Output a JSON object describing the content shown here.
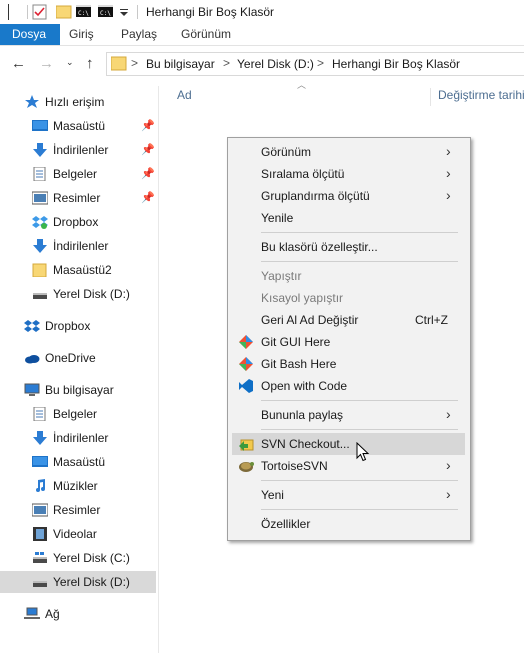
{
  "window": {
    "title": "Herhangi Bir Boş Klasör"
  },
  "ribbon": {
    "tabs": [
      "Dosya",
      "Giriş",
      "Paylaş",
      "Görünüm"
    ]
  },
  "address": {
    "crumbs": [
      "Bu bilgisayar",
      "Yerel Disk (D:)",
      "Herhangi Bir Boş Klasör"
    ],
    "separator": ">"
  },
  "nav": {
    "quick_access": "Hızlı erişim",
    "quick_items": [
      {
        "label": "Masaüstü",
        "icon": "desktop-icon",
        "pinned": true
      },
      {
        "label": "İndirilenler",
        "icon": "download-icon",
        "pinned": true
      },
      {
        "label": "Belgeler",
        "icon": "documents-icon",
        "pinned": true
      },
      {
        "label": "Resimler",
        "icon": "pictures-icon",
        "pinned": true
      },
      {
        "label": "Dropbox",
        "icon": "dropbox-icon",
        "pinned": false
      },
      {
        "label": "İndirilenler",
        "icon": "download-icon",
        "pinned": false
      },
      {
        "label": "Masaüstü2",
        "icon": "folder-icon",
        "pinned": false
      },
      {
        "label": "Yerel Disk (D:)",
        "icon": "drive-icon",
        "pinned": false
      }
    ],
    "dropbox": "Dropbox",
    "onedrive": "OneDrive",
    "this_pc": "Bu bilgisayar",
    "pc_items": [
      {
        "label": "Belgeler",
        "icon": "documents-icon"
      },
      {
        "label": "İndirilenler",
        "icon": "download-icon"
      },
      {
        "label": "Masaüstü",
        "icon": "desktop-icon"
      },
      {
        "label": "Müzikler",
        "icon": "music-icon"
      },
      {
        "label": "Resimler",
        "icon": "pictures-icon"
      },
      {
        "label": "Videolar",
        "icon": "videos-icon"
      },
      {
        "label": "Yerel Disk (C:)",
        "icon": "drive-icon"
      },
      {
        "label": "Yerel Disk (D:)",
        "icon": "drive-icon",
        "selected": true
      }
    ],
    "network": "Ağ"
  },
  "columns": {
    "name": "Ad",
    "modified": "Değiştirme tarihi"
  },
  "context_menu": {
    "items": [
      {
        "label": "Görünüm",
        "submenu": true
      },
      {
        "label": "Sıralama ölçütü",
        "submenu": true
      },
      {
        "label": "Gruplandırma ölçütü",
        "submenu": true
      },
      {
        "label": "Yenile"
      },
      {
        "label": "Bu klasörü özelleştir..."
      },
      {
        "label": "Yapıştır",
        "disabled": true
      },
      {
        "label": "Kısayol yapıştır",
        "disabled": true
      },
      {
        "label": "Geri Al Ad Değiştir",
        "shortcut": "Ctrl+Z"
      },
      {
        "label": "Git GUI Here",
        "icon": "git-icon"
      },
      {
        "label": "Git Bash Here",
        "icon": "git-icon"
      },
      {
        "label": "Open with Code",
        "icon": "vscode-icon"
      },
      {
        "label": "Bununla paylaş",
        "submenu": true
      },
      {
        "label": "SVN Checkout...",
        "icon": "svn-checkout-icon",
        "hover": true
      },
      {
        "label": "TortoiseSVN",
        "icon": "tortoise-icon",
        "submenu": true
      },
      {
        "label": "Yeni",
        "submenu": true
      },
      {
        "label": "Özellikler"
      }
    ]
  },
  "colors": {
    "accent": "#1979ca",
    "menu_bg": "#f2f2f2",
    "menu_hover": "#d7d7d7",
    "selected_nav": "#d9d9d9"
  }
}
